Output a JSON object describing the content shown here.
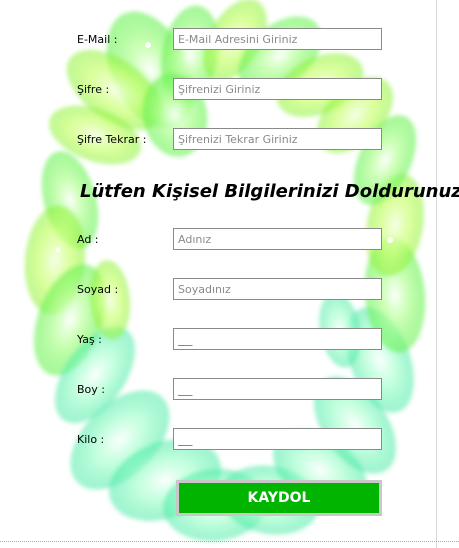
{
  "form": {
    "email": {
      "label": "E-Mail :",
      "placeholder": "E-Mail Adresini Giriniz"
    },
    "password": {
      "label": "Şifre :",
      "placeholder": "Şifrenizi Giriniz"
    },
    "password_repeat": {
      "label": "Şifre Tekrar :",
      "placeholder": "Şifrenizi Tekrar Giriniz"
    },
    "section_heading": "Lütfen Kişisel Bilgilerinizi Doldurunuz",
    "first_name": {
      "label": "Ad :",
      "placeholder": "Adınız"
    },
    "last_name": {
      "label": "Soyad :",
      "placeholder": "Soyadınız"
    },
    "age": {
      "label": "Yaş :",
      "value": "__"
    },
    "height": {
      "label": "Boy :",
      "value": "__"
    },
    "weight": {
      "label": "Kilo :",
      "value": "__"
    },
    "submit_label": "KAYDOL"
  },
  "colors": {
    "submit_button": "#00b400",
    "background_flowers": "#90f070"
  }
}
